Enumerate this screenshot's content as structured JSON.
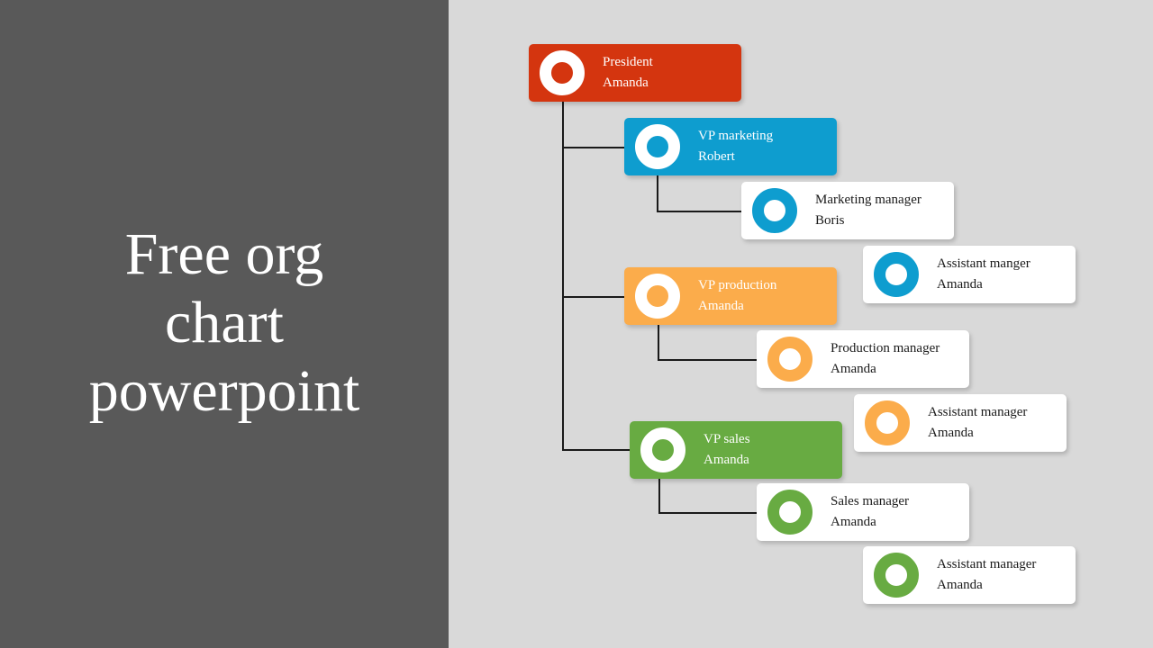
{
  "title": {
    "lines": [
      "Free org",
      "chart",
      "powerpoint"
    ]
  },
  "colors": {
    "left_panel": "#595959",
    "background": "#d9d9d9",
    "president": "#d4350f",
    "marketing": "#0e9dcf",
    "production": "#fbac4b",
    "sales": "#68ab42",
    "connector": "#1a1a1a",
    "card": "#ffffff"
  },
  "org_chart": {
    "president": {
      "role": "President",
      "name": "Amanda"
    },
    "departments": [
      {
        "id": "marketing",
        "vp": {
          "role": "VP marketing",
          "name": "Robert"
        },
        "manager": {
          "role": "Marketing manager",
          "name": "Boris"
        },
        "assistant": {
          "role": "Assistant manger",
          "name": "Amanda"
        }
      },
      {
        "id": "production",
        "vp": {
          "role": "VP production",
          "name": "Amanda"
        },
        "manager": {
          "role": "Production manager",
          "name": "Amanda"
        },
        "assistant": {
          "role": "Assistant manager",
          "name": "Amanda"
        }
      },
      {
        "id": "sales",
        "vp": {
          "role": "VP sales",
          "name": "Amanda"
        },
        "manager": {
          "role": "Sales manager",
          "name": "Amanda"
        },
        "assistant": {
          "role": "Assistant manager",
          "name": "Amanda"
        }
      }
    ]
  }
}
